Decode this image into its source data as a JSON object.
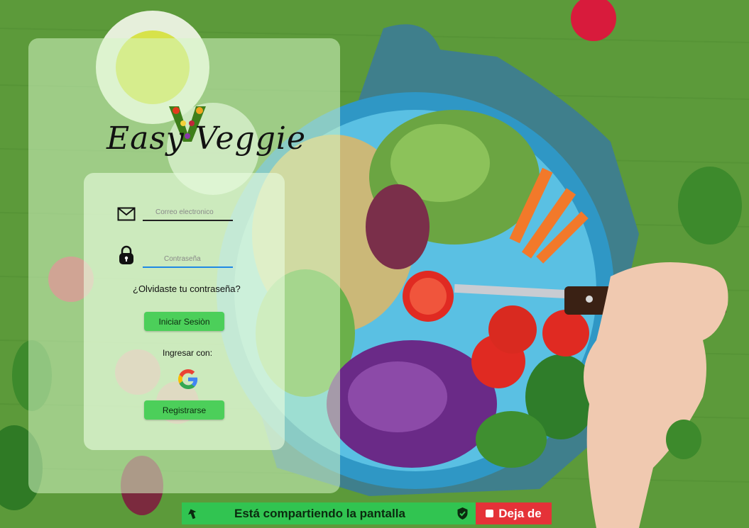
{
  "brand": {
    "logo_text": "Easy Veggie"
  },
  "login": {
    "email_placeholder": "Correo electronico",
    "password_placeholder": "Contraseña",
    "forgot_label": "¿Olvidaste tu contraseña?",
    "login_label": "Iniciar Sesiòn",
    "with_label": "Ingresar con:",
    "signup_label": "Registrarse"
  },
  "icons": {
    "email": "mail-icon",
    "password": "lock-icon",
    "google": "google-icon",
    "share": "share-arrow-icon",
    "shield": "shield-check-icon",
    "stop": "stop-square-icon"
  },
  "share_bar": {
    "message": "Está compartiendo la pantalla",
    "stop_label": "Deja de"
  },
  "colors": {
    "button_green": "#4ccf5a",
    "share_green": "#31c451",
    "stop_red": "#e53238",
    "password_underline": "#1e88e5"
  }
}
